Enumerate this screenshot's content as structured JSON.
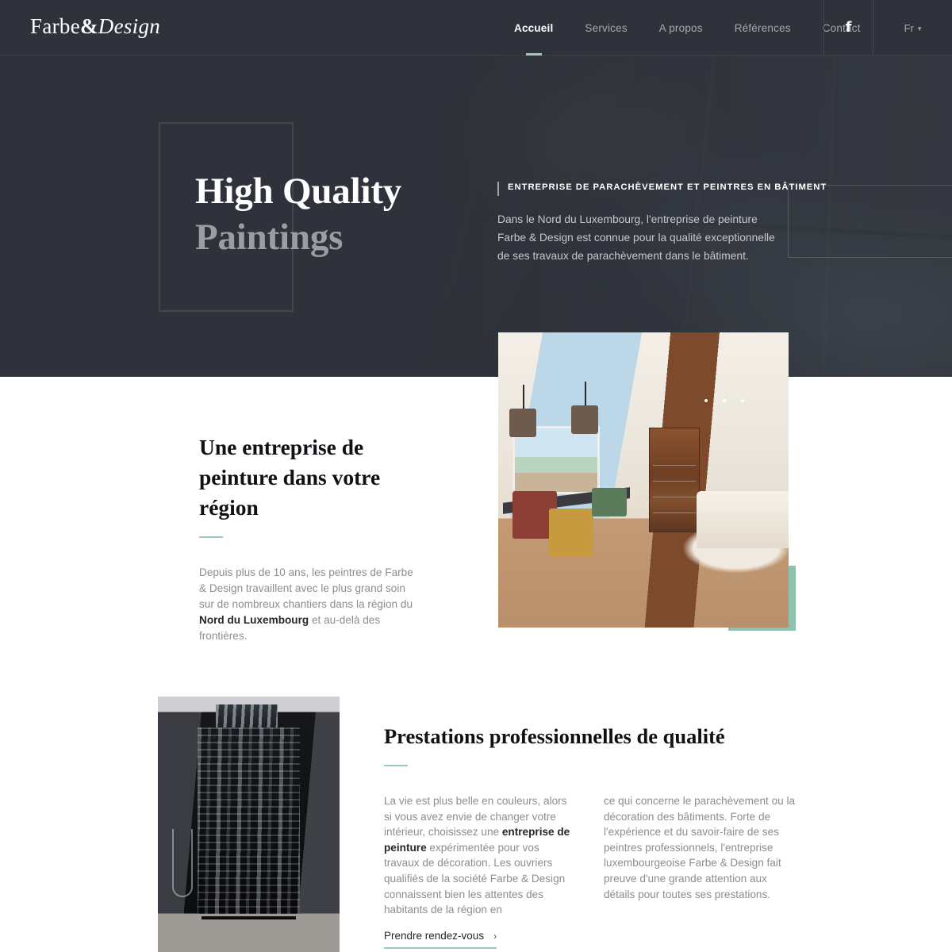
{
  "brand": {
    "name_part1": "Farbe",
    "amp": "&",
    "name_part2": "Design"
  },
  "header": {
    "nav": [
      {
        "label": "Accueil",
        "active": true
      },
      {
        "label": "Services",
        "active": false
      },
      {
        "label": "A propos",
        "active": false
      },
      {
        "label": "Références",
        "active": false
      },
      {
        "label": "Contact",
        "active": false
      }
    ],
    "facebook_icon": "facebook-icon",
    "facebook_glyph": "f",
    "language": "Fr",
    "language_chevron": "▾"
  },
  "hero": {
    "title_line1": "High Quality",
    "title_line2": "Paintings",
    "eyebrow": "ENTREPRISE DE PARACHÈVEMENT ET PEINTRES EN BÂTIMENT",
    "paragraph": "Dans le Nord du Luxembourg, l'entreprise de peinture Farbe & Design est connue pour la qualité exceptionnelle de ses travaux de parachèvement dans le bâtiment."
  },
  "section_region": {
    "heading": "Une entreprise de peinture dans votre région",
    "paragraph_before": "Depuis plus de 10 ans, les peintres de Farbe & Design travaillent avec le plus grand soin sur de nombreux chantiers dans la région du ",
    "paragraph_bold": "Nord du Luxembourg",
    "paragraph_after": " et au-delà des frontières.",
    "image_alt": "salle-a-manger-salon-interieur"
  },
  "section_services": {
    "heading": "Prestations professionnelles de qualité",
    "col_left_before": "La vie est plus belle en couleurs, alors si vous avez envie de changer votre intérieur, choisissez une ",
    "col_left_bold": "entreprise de peinture",
    "col_left_after": " expérimentée pour vos travaux de décoration. Les ouvriers qualifiés de la société Farbe & Design connaissent bien les attentes des habitants de la région en",
    "col_right": "ce qui concerne le parachèvement ou la décoration des bâtiments. Forte de l'expérience et du savoir-faire de ses peintres professionnels, l'entreprise luxembourgeoise Farbe & Design fait preuve d'une grande attention aux détails pour toutes ses prestations.",
    "cta_label": "Prendre rendez-vous",
    "cta_arrow": "›",
    "image_alt": "salle-de-bain-douche-pierre-noire"
  },
  "colors": {
    "dark": "#2f323a",
    "accent_green": "#8fc2ae",
    "rule_green": "#9cc9b8",
    "body_text": "#8a8d93",
    "heading": "#101114"
  }
}
